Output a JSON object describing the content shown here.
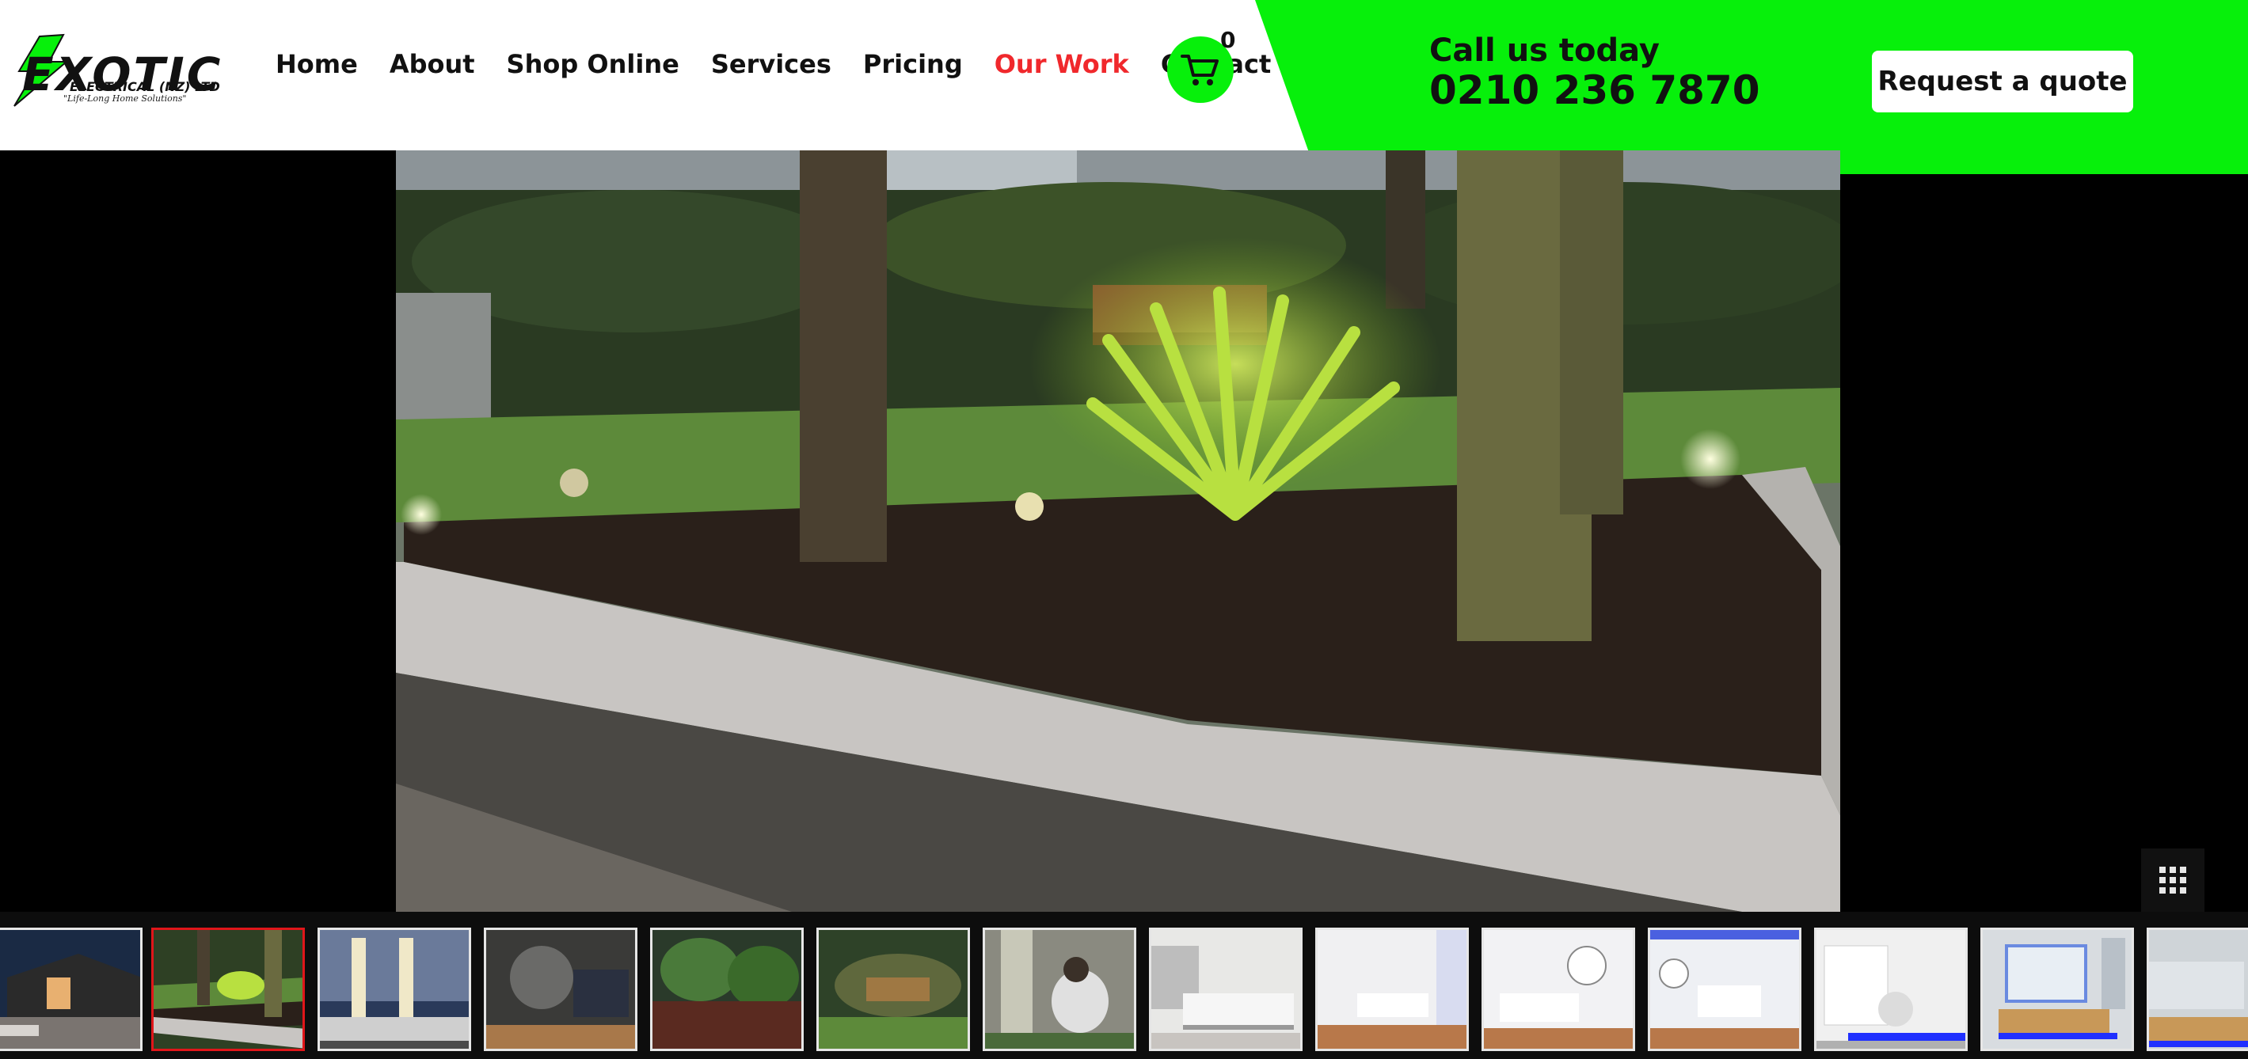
{
  "logo": {
    "brand": "EXOTIC",
    "sub": "ELECTRICAL (NZ) LTD",
    "tagline": "\"Life-Long Home Solutions\""
  },
  "nav": [
    {
      "label": "Home",
      "active": false
    },
    {
      "label": "About",
      "active": false
    },
    {
      "label": "Shop Online",
      "active": false
    },
    {
      "label": "Services",
      "active": false
    },
    {
      "label": "Pricing",
      "active": false
    },
    {
      "label": "Our Work",
      "active": true
    },
    {
      "label": "Contact",
      "active": false
    }
  ],
  "cart": {
    "count": "0",
    "icon": "cart-icon"
  },
  "call": {
    "line1": "Call us today",
    "phone": "0210 236 7870"
  },
  "quote_button": "Request a quote",
  "colors": {
    "accent_green": "#07f00b",
    "active_red": "#f0282c",
    "thumb_active_border": "#e0161a"
  },
  "gallery": {
    "grid_icon": "grid-icon",
    "thumbnails": [
      {
        "theme": "house-exterior-path-lights",
        "active": false
      },
      {
        "theme": "garden-bed-night-lights",
        "active": true
      },
      {
        "theme": "planter-wall-uplights",
        "active": false
      },
      {
        "theme": "deck-wicker-furniture",
        "active": false
      },
      {
        "theme": "tropical-garden-deck",
        "active": false
      },
      {
        "theme": "garden-bench-hedge-lights",
        "active": false
      },
      {
        "theme": "person-installing-garden-light",
        "active": false
      },
      {
        "theme": "white-kitchen-island",
        "active": false
      },
      {
        "theme": "white-dining-kitchen",
        "active": false
      },
      {
        "theme": "white-kitchen-dining-clock",
        "active": false
      },
      {
        "theme": "dining-room-blue-led",
        "active": false
      },
      {
        "theme": "laundry-blue-led",
        "active": false
      },
      {
        "theme": "bathroom-vanity-blue-led",
        "active": false
      },
      {
        "theme": "bathroom-partial",
        "active": false
      }
    ]
  }
}
